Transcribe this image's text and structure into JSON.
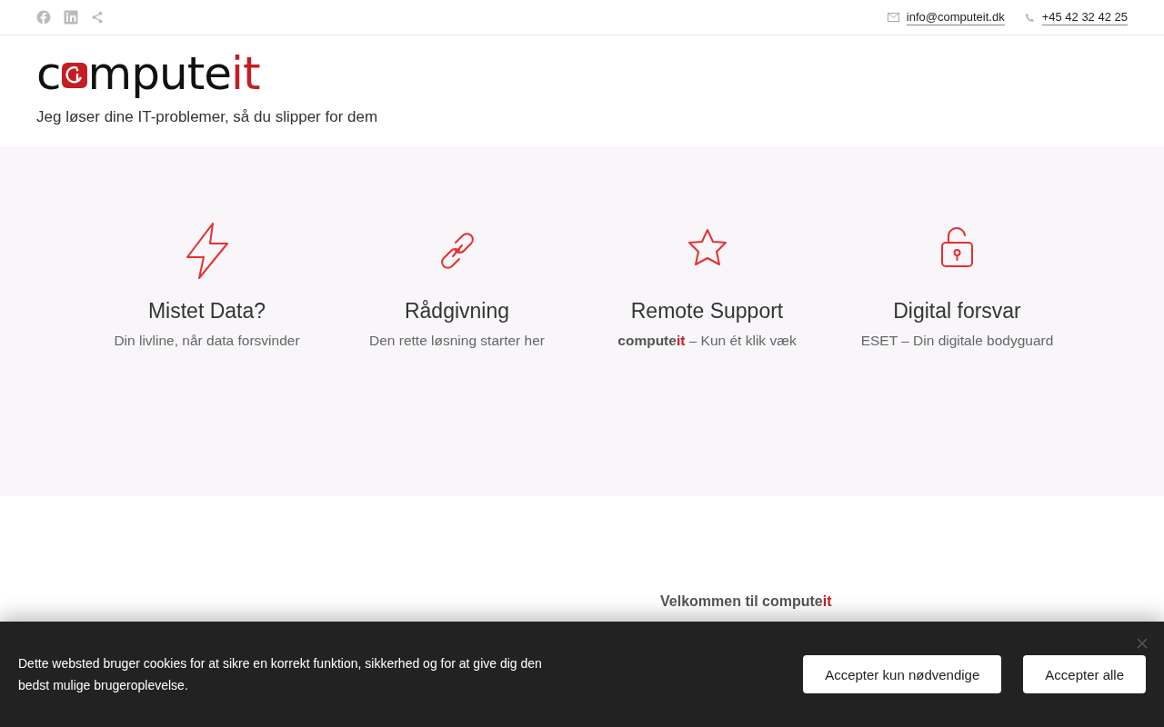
{
  "topbar": {
    "social": [
      {
        "kind": "facebook"
      },
      {
        "kind": "linkedin"
      },
      {
        "kind": "share"
      }
    ],
    "contacts": [
      {
        "kind": "email",
        "text": "info@computeit.dk"
      },
      {
        "kind": "phone",
        "text": "+45 42 32 42 25"
      }
    ]
  },
  "header": {
    "logo": {
      "before": "c",
      "after": "mpute",
      "accent": "it"
    },
    "tagline": "Jeg løser dine IT-problemer, så du slipper for dem"
  },
  "features": [
    {
      "kind": "bolt",
      "title": "Mistet Data?",
      "subtitle": {
        "text": "Din livline, når data forsvinder"
      }
    },
    {
      "kind": "link",
      "title": "Rådgivning",
      "subtitle": {
        "text": "Den rette løsning starter her"
      }
    },
    {
      "kind": "star",
      "title": "Remote Support",
      "subtitle": {
        "brand": "compute",
        "accent": "it",
        "text": " – Kun ét klik væk"
      }
    },
    {
      "kind": "lock",
      "title": "Digital forsvar",
      "subtitle": {
        "text": "ESET – Din digitale bodyguard"
      }
    }
  ],
  "about": {
    "intro": {
      "text": "Velkommen til compute",
      "accent": "it"
    }
  },
  "cookie_bar": {
    "message": "Dette websted bruger cookies for at sikre en korrekt funktion, sikkerhed og for at give dig den bedst mulige brugeroplevelse.",
    "buttons": [
      "Accepter kun nødvendige",
      "Accepter alle"
    ]
  }
}
